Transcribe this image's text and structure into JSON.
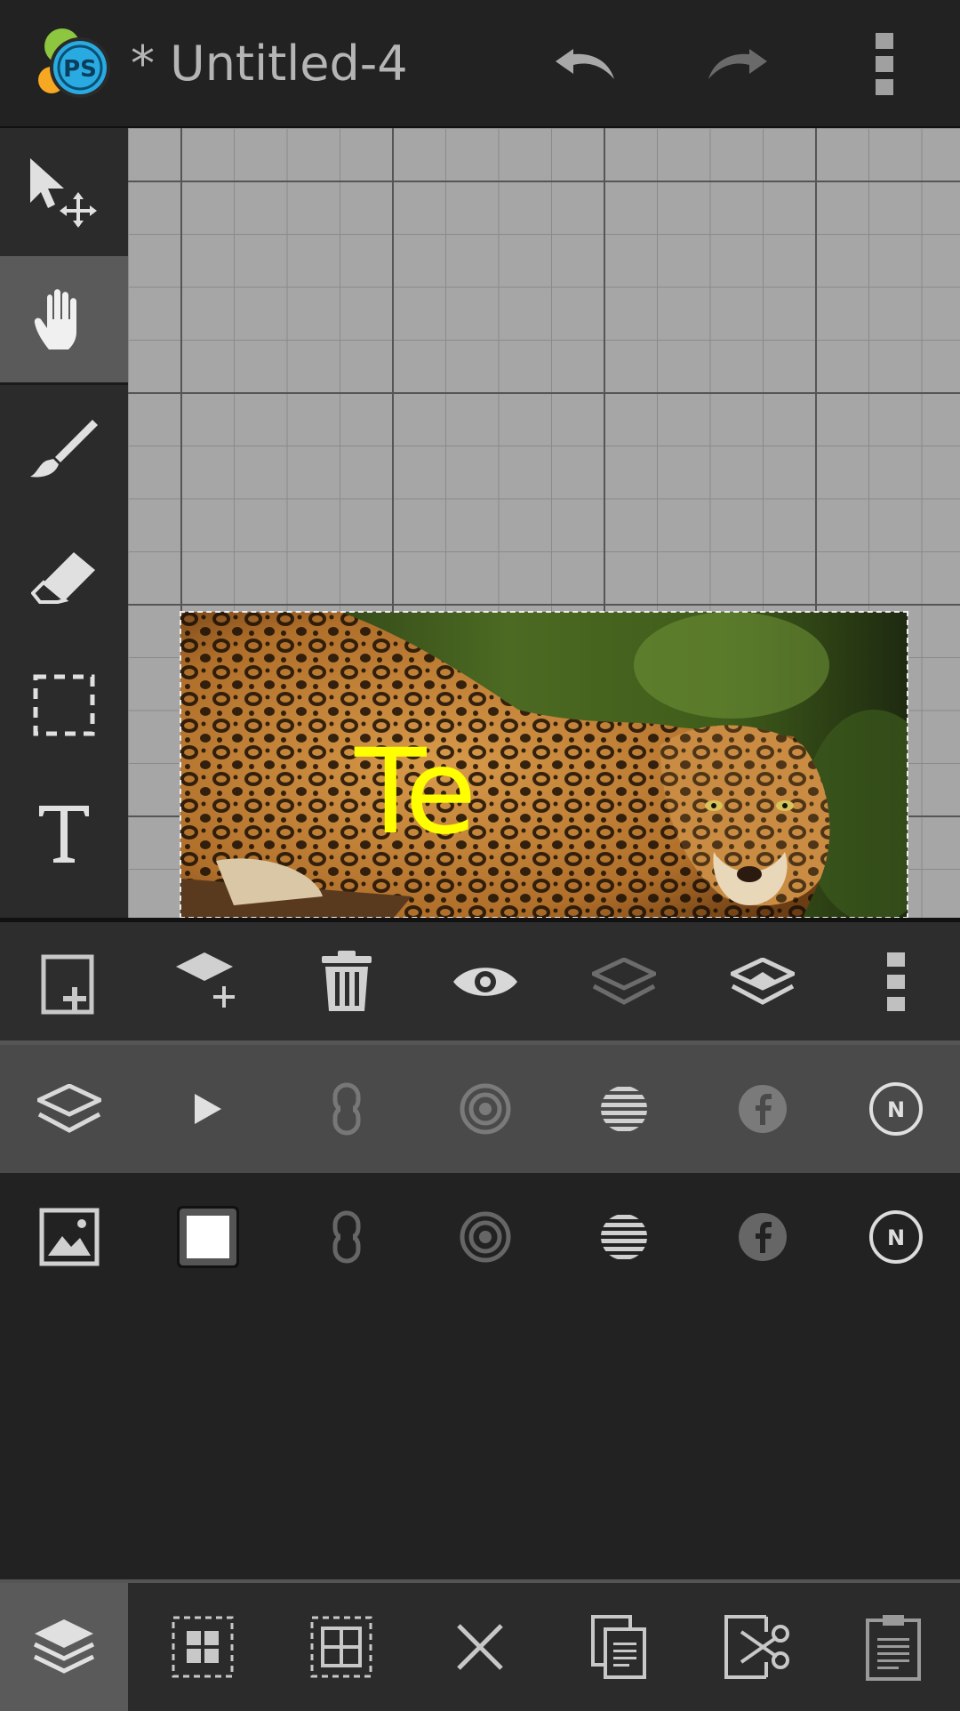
{
  "app": {
    "logo_text": "PS",
    "document_title": "* Untitled-4",
    "actions": {
      "undo": "undo-icon",
      "redo": "redo-icon",
      "overflow": "more-vert-icon"
    }
  },
  "tools": [
    {
      "name": "move-tool",
      "icon": "move-icon",
      "active": false
    },
    {
      "name": "pan-tool",
      "icon": "hand-icon",
      "active": true
    },
    {
      "name": "brush-tool",
      "icon": "brush-icon",
      "active": false
    },
    {
      "name": "eraser-tool",
      "icon": "eraser-icon",
      "active": false
    },
    {
      "name": "marquee-tool",
      "icon": "marquee-icon",
      "active": false
    },
    {
      "name": "text-tool",
      "icon": "text-icon",
      "active": false
    }
  ],
  "canvas": {
    "layer_text": "Te",
    "text_color": "#ffff00",
    "image_subject": "jaguar photo"
  },
  "layer_actions": [
    "add-layer",
    "add-fill-layer",
    "delete-layer",
    "toggle-visibility",
    "merge-down",
    "flatten-layers",
    "more"
  ],
  "layers": [
    {
      "type": "text layer",
      "selected": true
    },
    {
      "type": "image layer",
      "selected": false
    }
  ],
  "layer_row_icons": [
    "link-icon",
    "opacity-icon",
    "blend-icon",
    "facebook-icon",
    "normal-mode-icon"
  ],
  "blend_mode_badge": "N",
  "bottom_actions": [
    "layers",
    "select-all",
    "select-grid",
    "clear",
    "copy",
    "cut",
    "paste"
  ],
  "colors": {
    "background": "#222222",
    "selected_row": "#4a4a4a",
    "accent_text": "#ffff00",
    "logo_blue": "#29abe2",
    "logo_green": "#8dc63f",
    "logo_orange": "#f7a823"
  }
}
